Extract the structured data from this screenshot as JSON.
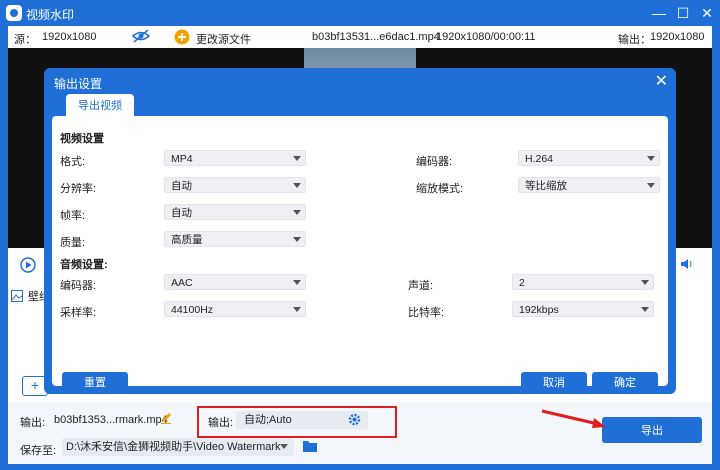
{
  "window": {
    "title": "视频水印",
    "controls": [
      "minimize",
      "maximize",
      "close"
    ]
  },
  "infobar": {
    "source_label": "源：",
    "source_res": "1920x1080",
    "change_source": "更改源文件",
    "filename": "b03bf13531...e6dac1.mp4",
    "file_info": "1920x1080/00:00:11",
    "output_label": "输出：",
    "output_res": "1920x1080"
  },
  "panel": {
    "watermark_tab": "壁纸"
  },
  "dialog": {
    "title": "输出设置",
    "tab": "导出视频",
    "video_section": "视频设置",
    "format_label": "格式:",
    "format_value": "MP4",
    "encoder_label": "编码器:",
    "encoder_value": "H.264",
    "resolution_label": "分辨率:",
    "resolution_value": "自动",
    "zoom_label": "缩放模式:",
    "zoom_value": "等比缩放",
    "framerate_label": "帧率:",
    "framerate_value": "自动",
    "quality_label": "质量:",
    "quality_value": "高质量",
    "audio_section": "音频设置:",
    "audio_encoder_label": "编码器:",
    "audio_encoder_value": "AAC",
    "channel_label": "声道:",
    "channel_value": "2",
    "samplerate_label": "采样率:",
    "samplerate_value": "44100Hz",
    "bitrate_label": "比特率:",
    "bitrate_value": "192kbps",
    "reset_button": "重置",
    "cancel_button": "取消",
    "ok_button": "确定"
  },
  "bottom": {
    "output_label": "输出:",
    "output_file": "b03bf1353...rmark.mp4",
    "output_setting_label": "输出:",
    "output_setting_value": "自动;Auto",
    "save_label": "保存至:",
    "save_path": "D:\\沐禾安信\\金狮视频助手\\Video Watermark",
    "export_button": "导出"
  },
  "colors": {
    "accent": "#1f6fd6",
    "highlight": "#e02020",
    "warning": "#f5a100"
  }
}
